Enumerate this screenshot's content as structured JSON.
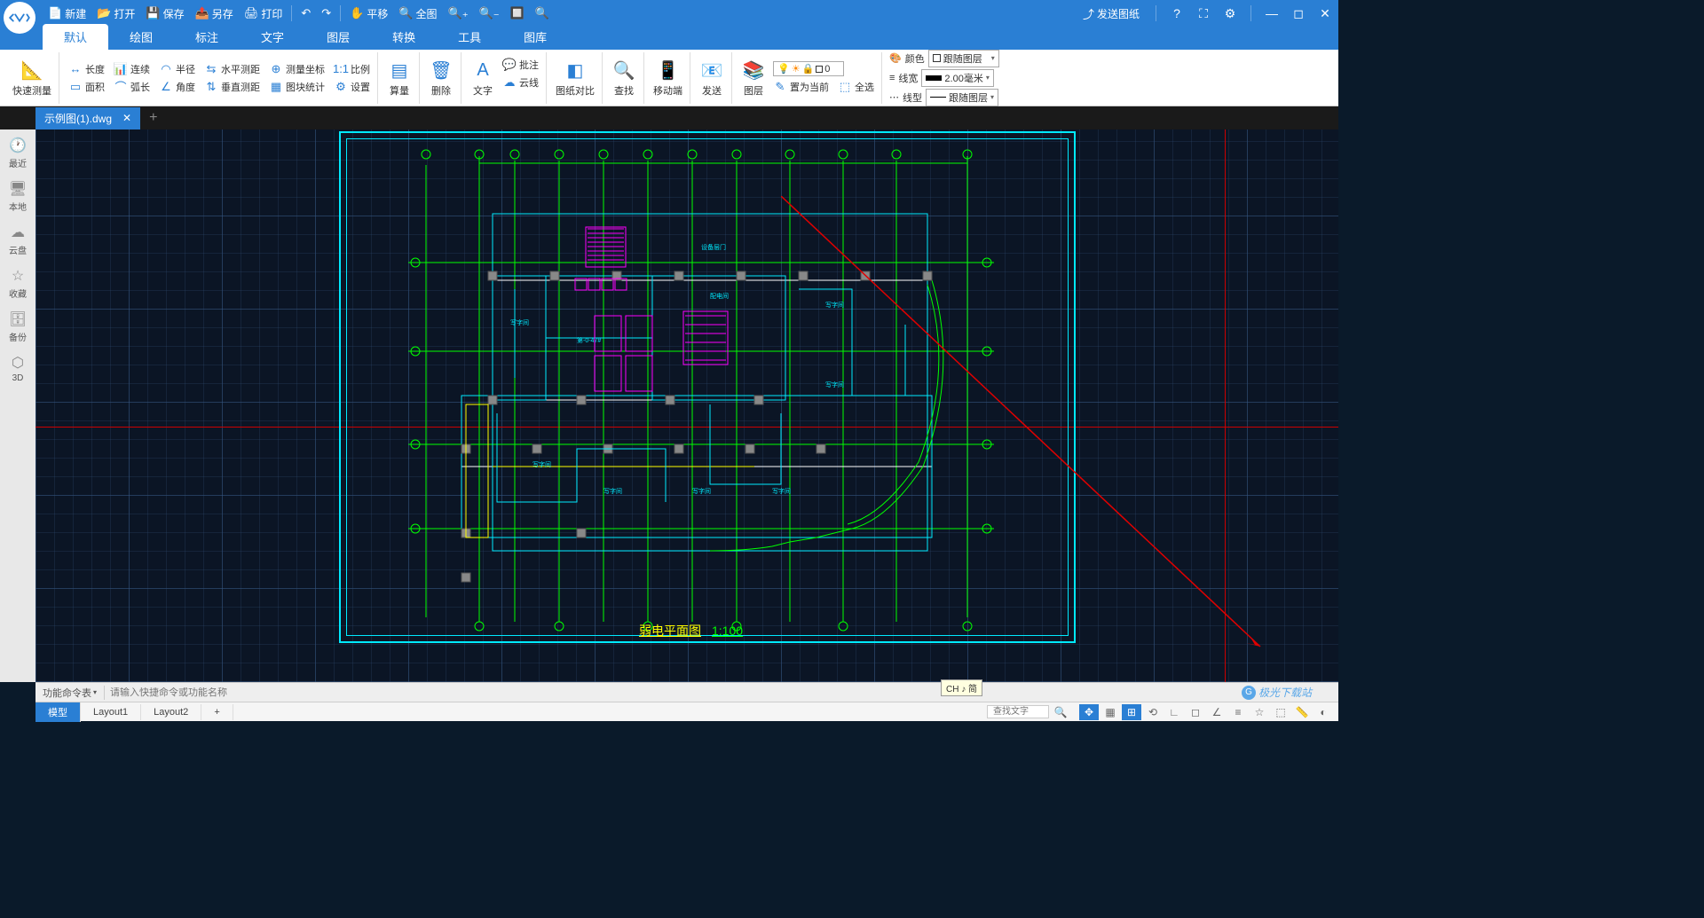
{
  "titlebar": {
    "buttons": {
      "new": "新建",
      "open": "打开",
      "save": "保存",
      "saveas": "另存",
      "print": "打印"
    },
    "pan": "平移",
    "full": "全图",
    "send": "发送图纸"
  },
  "menu": {
    "tabs": [
      "默认",
      "绘图",
      "标注",
      "文字",
      "图层",
      "转换",
      "工具",
      "图库"
    ]
  },
  "ribbon": {
    "quick": "快速测量",
    "length": "长度",
    "cont": "连续",
    "radius": "半径",
    "hdist": "水平测距",
    "coord": "测量坐标",
    "scale": "比例",
    "area": "面积",
    "arc": "弧长",
    "angle": "角度",
    "vdist": "垂直测距",
    "blkstat": "图块统计",
    "settings": "设置",
    "calc": "算量",
    "delete": "删除",
    "text": "文字",
    "note": "批注",
    "cloud": "云线",
    "compare": "图纸对比",
    "find": "查找",
    "mobile": "移动端",
    "sendbig": "发送",
    "layer": "图层",
    "setcurrent": "置为当前",
    "selectall": "全选",
    "layerval": "0",
    "color_lbl": "颜色",
    "color_val": "跟随图层",
    "lwt_lbl": "线宽",
    "lwt_val": "2.00毫米",
    "ltype_lbl": "线型",
    "ltype_val": "跟随图层"
  },
  "filetab": {
    "name": "示例图(1).dwg"
  },
  "sidebar": {
    "recent": "最近",
    "local": "本地",
    "cloud": "云盘",
    "fav": "收藏",
    "backup": "备份",
    "td": "3D"
  },
  "cmdbar": {
    "label": "功能命令表",
    "placeholder": "请输入快捷命令或功能名称"
  },
  "layouts": [
    "模型",
    "Layout1",
    "Layout2"
  ],
  "search_placeholder": "查找文字",
  "tooltip": "CH ♪ 简",
  "drawing": {
    "title": "弱电平面图",
    "scale": "1:100"
  },
  "watermark": "极光下载站"
}
